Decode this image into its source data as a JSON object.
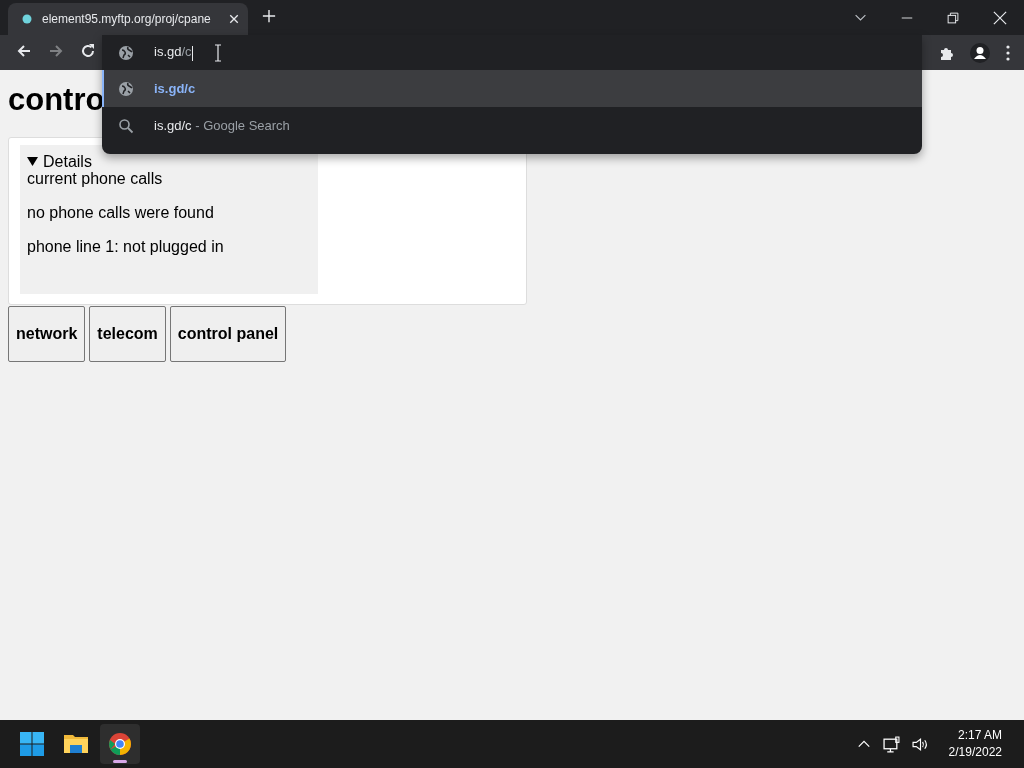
{
  "tab": {
    "title": "element95.myftp.org/proj/cpane",
    "active": true
  },
  "omnibox": {
    "typed": "is.gd",
    "completion": "/c"
  },
  "toolbar": {
    "back_disabled": false,
    "forward_disabled": true
  },
  "suggestions": [
    {
      "kind": "url",
      "text": "is.gd/c",
      "selected": true
    },
    {
      "kind": "search",
      "text": "is.gd/c",
      "hint": " - Google Search",
      "selected": false
    }
  ],
  "page": {
    "heading": "contro",
    "details": {
      "summary": "Details",
      "expanded": true,
      "lines": [
        "current phone calls",
        "no phone calls were found",
        "phone line 1: not plugged in"
      ]
    },
    "buttons": [
      "network",
      "telecom",
      "control panel"
    ]
  },
  "taskbar": {
    "apps": [
      {
        "kind": "start",
        "active": false
      },
      {
        "kind": "files",
        "active": false
      },
      {
        "kind": "browser",
        "active": true
      }
    ],
    "time": "2:17 AM",
    "date": "2/19/2022"
  }
}
